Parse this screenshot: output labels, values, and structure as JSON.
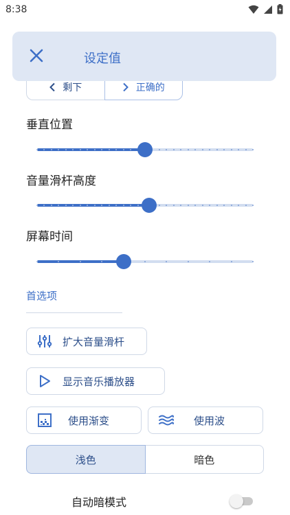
{
  "status_bar": {
    "time": "8:38"
  },
  "header": {
    "title": "设定值",
    "close_icon": "close-icon"
  },
  "nav_segment": {
    "left_label": "剩下",
    "right_label": "正确的"
  },
  "sliders": [
    {
      "label": "垂直位置",
      "value": 0.5
    },
    {
      "label": "音量滑杆高度",
      "value": 0.52
    },
    {
      "label": "屏幕时间",
      "value": 0.4
    }
  ],
  "preferences": {
    "title": "首选项",
    "expand_volume_slider": "扩大音量滑杆",
    "show_music_player": "显示音乐播放器",
    "use_gradient": "使用渐变",
    "use_wave": "使用波"
  },
  "theme": {
    "light": "浅色",
    "dark": "暗色",
    "selected": "light"
  },
  "auto_dark": {
    "label": "自动暗模式",
    "enabled": false
  },
  "colors": {
    "accent": "#3d6fc7",
    "header_bg": "#dfe7f4",
    "track": "#d2ddf0"
  }
}
